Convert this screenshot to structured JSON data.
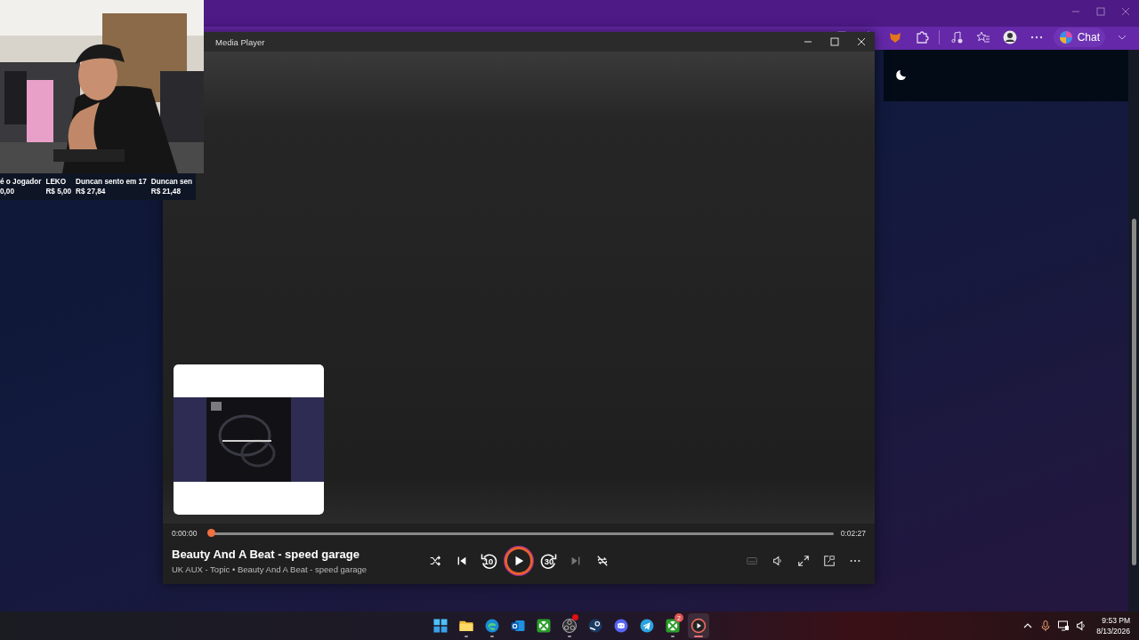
{
  "browser": {
    "chat_button": {
      "label": "Chat"
    }
  },
  "stream_overlay": {
    "donations": [
      {
        "name": "é o Jogador",
        "amount": "0,00"
      },
      {
        "name": "LEKO",
        "amount": "R$ 5,00"
      },
      {
        "name": "Duncan sento em 17",
        "amount": "R$ 27,84"
      },
      {
        "name": "Duncan sen",
        "amount": "R$ 21,48"
      }
    ]
  },
  "media_player": {
    "title": "Media Player",
    "elapsed": "0:00:00",
    "duration": "0:02:27",
    "progress": {
      "level": 0.0
    },
    "track_title": "Beauty And A Beat - speed garage",
    "track_subtitle": "UK AUX - Topic • Beauty And A Beat - speed garage",
    "controls": [
      {
        "kind": "shuffle",
        "disabled": false
      },
      {
        "kind": "previous",
        "disabled": false
      },
      {
        "kind": "rewind",
        "label": "10",
        "disabled": false
      },
      {
        "kind": "play",
        "disabled": false
      },
      {
        "kind": "forward",
        "label": "30",
        "disabled": false
      },
      {
        "kind": "next",
        "disabled": true
      },
      {
        "kind": "repeat",
        "disabled": false
      }
    ],
    "side_controls": [
      {
        "kind": "captions",
        "disabled": true
      },
      {
        "kind": "volume",
        "disabled": false
      },
      {
        "kind": "fullscreen",
        "disabled": false
      },
      {
        "kind": "miniplayer",
        "disabled": false
      },
      {
        "kind": "more",
        "disabled": false
      }
    ]
  },
  "taskbar": {
    "apps": [
      {
        "kind": "start",
        "running": false,
        "selected": false
      },
      {
        "kind": "files",
        "running": true,
        "selected": false
      },
      {
        "kind": "edge",
        "running": true,
        "selected": false
      },
      {
        "kind": "outlook",
        "running": false,
        "selected": false
      },
      {
        "kind": "xbox",
        "running": false,
        "selected": false
      },
      {
        "kind": "obs",
        "running": true,
        "selected": false,
        "alert": true
      },
      {
        "kind": "steam",
        "running": false,
        "selected": false
      },
      {
        "kind": "discord",
        "running": false,
        "selected": false
      },
      {
        "kind": "telegram",
        "running": false,
        "selected": false
      },
      {
        "kind": "xbox",
        "running": true,
        "selected": false,
        "badge": "2"
      },
      {
        "kind": "player",
        "running": true,
        "selected": true
      }
    ],
    "clock": {
      "time": "9:53 PM",
      "date": "8/13/2026"
    }
  }
}
